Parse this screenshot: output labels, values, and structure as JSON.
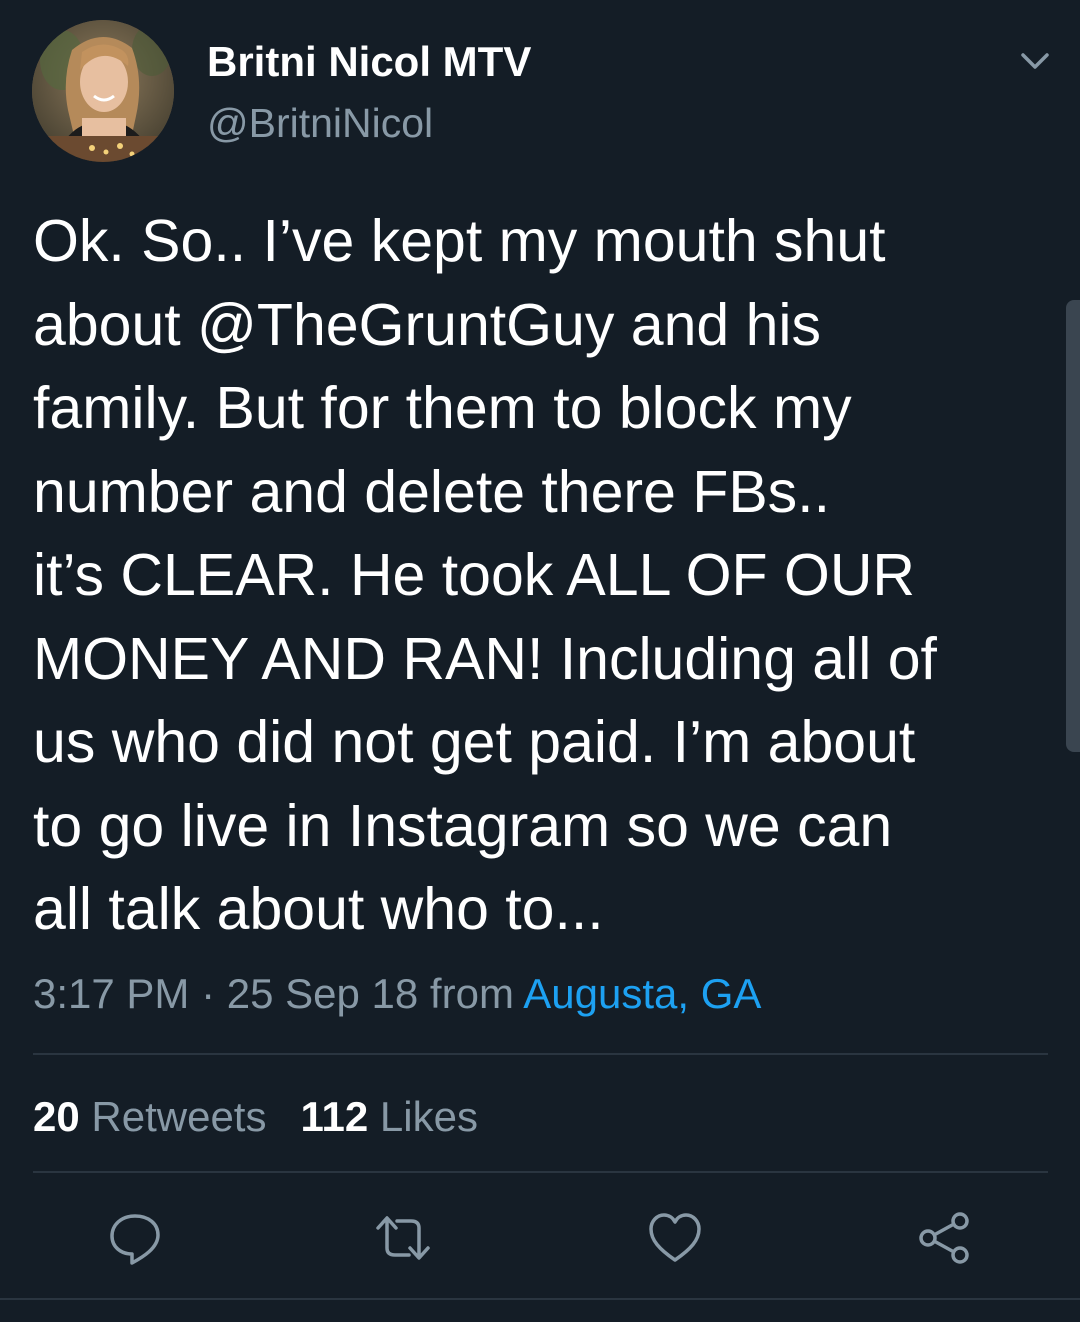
{
  "tweet": {
    "author": {
      "display_name": "Britni Nicol MTV",
      "handle": "@BritniNicol"
    },
    "text_lines": [
      "Ok. So.. I’ve kept my mouth shut",
      "about @TheGruntGuy and his",
      "family. But for them to block my",
      "number and delete there FBs..",
      "it’s CLEAR. He took ALL OF OUR",
      "MONEY AND RAN! Including all of",
      "us who did not get paid. I’m about",
      "to go live in Instagram so we can",
      "all talk about who to..."
    ],
    "time": "3:17 PM",
    "separator": " · ",
    "date": "25 Sep 18",
    "from_label": " from ",
    "location": "Augusta, GA",
    "retweets": {
      "count": "20",
      "label": "Retweets"
    },
    "likes": {
      "count": "112",
      "label": "Likes"
    }
  },
  "icons": {
    "caret": "chevron-down-icon",
    "reply": "reply-icon",
    "retweet": "retweet-icon",
    "like": "heart-icon",
    "share": "share-icon"
  },
  "colors": {
    "background": "#141d26",
    "text_primary": "#ffffff",
    "text_secondary": "#8899a6",
    "link": "#1da1f2",
    "divider": "#2a3540"
  }
}
